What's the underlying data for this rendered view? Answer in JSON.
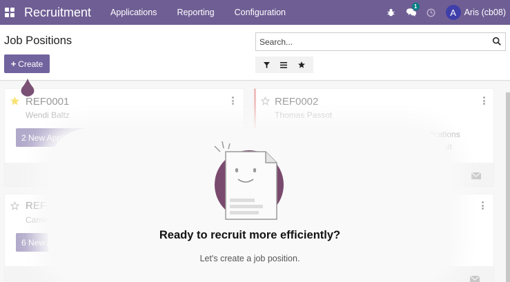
{
  "app": {
    "name": "Recruitment",
    "menu": [
      "Applications",
      "Reporting",
      "Configuration"
    ],
    "user": {
      "initial": "A",
      "name": "Aris (cb08)"
    },
    "chat_count": "1"
  },
  "control_panel": {
    "title": "Job Positions",
    "create_label": "Create",
    "search_placeholder": "Search..."
  },
  "colors": {
    "brand": "#6f5e94",
    "button": "#71639e",
    "avatar": "#3f3faa",
    "badge": "#017e84",
    "star_filled": "#f3cc00"
  },
  "cards": [
    {
      "ref": "REF0001",
      "name": "Wendi Baltz",
      "favorite": true,
      "button": "2 New Applications",
      "stats": []
    },
    {
      "ref": "REF0002",
      "name": "Thomas Passot",
      "favorite": false,
      "button": "",
      "stats": [
        "21 Applications",
        "To Recruit"
      ],
      "stat_partial": [
        "21 Applications",
        "cruit"
      ]
    },
    {
      "ref": "REF0003",
      "ref_partial": "REF",
      "name": "Carrie",
      "favorite": false,
      "button": "6 New Applications",
      "button_partial": "6 New A"
    }
  ],
  "helper": {
    "title": "Ready to recruit more efficiently?",
    "subtitle": "Let's create a job position."
  },
  "icons": [
    "apps-grid-icon",
    "bug-icon",
    "chat-icon",
    "clock-icon",
    "search-icon",
    "filter-icon",
    "group-by-icon",
    "favorites-star-icon",
    "kebab-menu-icon",
    "envelope-icon",
    "star-icon"
  ]
}
